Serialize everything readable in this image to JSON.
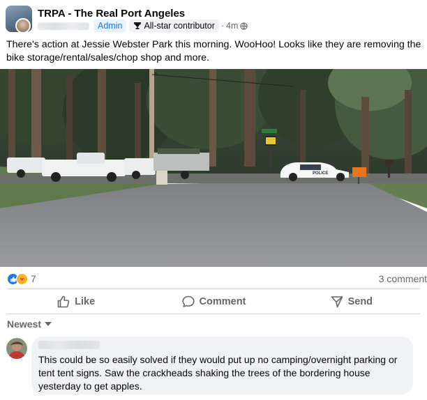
{
  "post": {
    "group_name": "TRPA - The Real Port Angeles",
    "role_badge": "Admin",
    "contributor_badge": "All-star contributor",
    "separator": "·",
    "time": "4m",
    "audience_icon": "globe-icon",
    "text": "There's action at Jessie Webster Park this morning. WooHoo! Looks like they are removing the bike storage/rental/sales/chop shop and more.",
    "image_sign_text": "POLICE"
  },
  "reactions": {
    "icons": [
      "like-icon",
      "care-icon"
    ],
    "count": "7",
    "comments_label": "3 comment"
  },
  "actions": {
    "like_label": "Like",
    "comment_label": "Comment",
    "send_label": "Send"
  },
  "comments": {
    "sort_label": "Newest",
    "items": [
      {
        "text": "This could be so easily solved if they would put up no camping/overnight parking or tent tent signs. Saw the crackheads shaking the trees of the bordering house yesterday to get apples."
      }
    ]
  },
  "colors": {
    "accent_blue": "#1b74e4",
    "secondary_text": "#65676b",
    "bubble_bg": "#f0f2f5",
    "divider": "#ced0d4"
  }
}
